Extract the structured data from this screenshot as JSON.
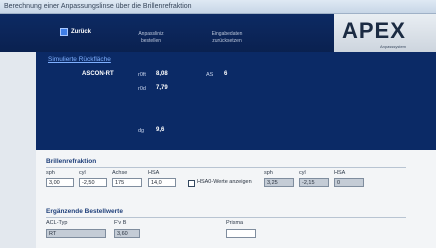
{
  "window": {
    "title": "Berechnung einer Anpassungslinse über die Brillenrefraktion"
  },
  "toolbar": {
    "back_label": "Zurück",
    "tab1_line1": "Anpassliniz",
    "tab1_line2": "bestellen",
    "tab2_line1": "Eingabedaten",
    "tab2_line2": "zurücksetzen"
  },
  "logo": {
    "name": "APEX",
    "tagline": "Anpasssystem"
  },
  "simulated_panel": {
    "label": "Simulierte Rückfläche",
    "lens_name": "ASCON-RT",
    "r0_label": "r0ft",
    "r0_value": "8,08",
    "r0d_label": "r0d",
    "r0d_value": "7,79",
    "as_label": "AS",
    "as_value": "6",
    "dg_label": "dg",
    "dg_value": "9,6"
  },
  "refraction": {
    "title": "Brillenrefraktion",
    "labels": [
      "sph",
      "cyl",
      "Achse",
      "HSA"
    ],
    "values": [
      "3,00",
      "-2,50",
      "175",
      "14,0"
    ],
    "checkbox_label": "HSA0-Werte anzeigen",
    "result_labels": [
      "sph",
      "cyl",
      "HSA"
    ],
    "result_values": [
      "3,25",
      "-2,15",
      "0"
    ]
  },
  "order": {
    "title": "Ergänzende Bestellwerte",
    "acl_label": "ACL-Typ",
    "acl_value": "RT",
    "fv_label": "F'v B",
    "fv_value": "3,60",
    "prism_label": "Prisma",
    "prism_value": ""
  }
}
